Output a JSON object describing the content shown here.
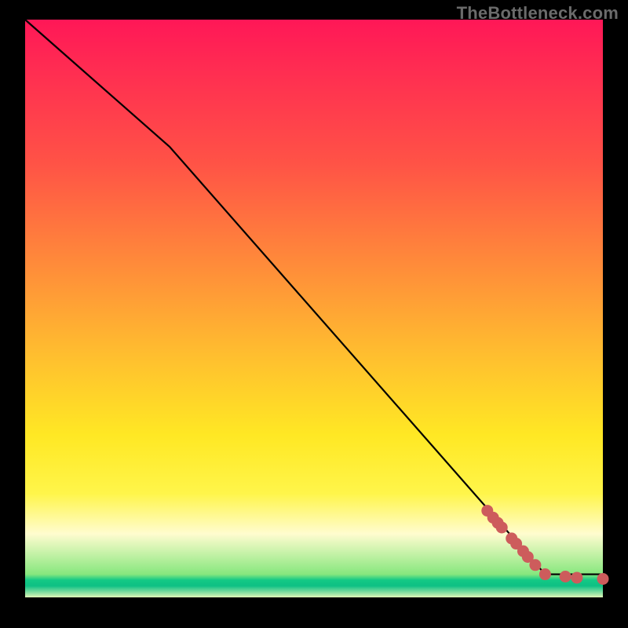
{
  "watermark": "TheBottleneck.com",
  "chart_data": {
    "type": "line",
    "title": "",
    "xlabel": "",
    "ylabel": "",
    "xlim": [
      0,
      100
    ],
    "ylim": [
      0,
      100
    ],
    "line": [
      {
        "x": 0,
        "y": 100
      },
      {
        "x": 25,
        "y": 78
      },
      {
        "x": 90,
        "y": 4
      },
      {
        "x": 100,
        "y": 4
      }
    ],
    "points": [
      {
        "x": 80.0,
        "y": 15.0
      },
      {
        "x": 81.0,
        "y": 13.8
      },
      {
        "x": 81.8,
        "y": 12.9
      },
      {
        "x": 82.5,
        "y": 12.1
      },
      {
        "x": 84.2,
        "y": 10.2
      },
      {
        "x": 85.0,
        "y": 9.3
      },
      {
        "x": 86.2,
        "y": 8.0
      },
      {
        "x": 87.0,
        "y": 7.0
      },
      {
        "x": 88.3,
        "y": 5.6
      },
      {
        "x": 90.0,
        "y": 4.0
      },
      {
        "x": 93.5,
        "y": 3.6
      },
      {
        "x": 95.5,
        "y": 3.4
      },
      {
        "x": 100.0,
        "y": 3.2
      }
    ],
    "colors": {
      "line": "#000000",
      "point_fill": "#cd5c5c",
      "point_stroke": "#cd5c5c",
      "gradient_stops": [
        "#ff1757",
        "#ff5346",
        "#ff8a3a",
        "#ffbe2f",
        "#ffe824",
        "#fffccf",
        "#14c985"
      ]
    }
  }
}
